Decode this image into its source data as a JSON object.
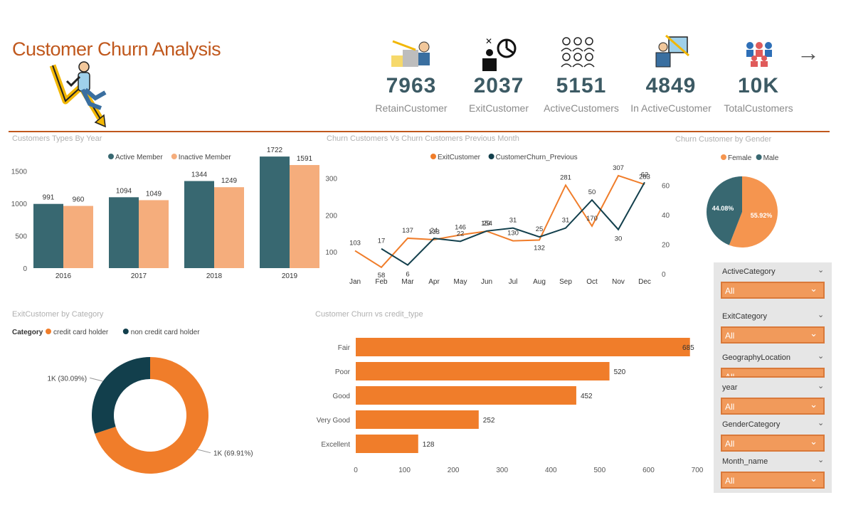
{
  "header": {
    "title": "Customer Churn Analysis",
    "next_icon": "arrow-right-icon"
  },
  "kpis": [
    {
      "value": "7963",
      "label": "RetainCustomer",
      "icon": "retain-customer-icon"
    },
    {
      "value": "2037",
      "label": "ExitCustomer",
      "icon": "exit-customer-icon"
    },
    {
      "value": "5151",
      "label": "ActiveCustomers",
      "icon": "active-customers-icon"
    },
    {
      "value": "4849",
      "label": "In ActiveCustomer",
      "icon": "inactive-customer-icon"
    },
    {
      "value": "10K",
      "label": "TotalCustomers",
      "icon": "total-customers-icon"
    }
  ],
  "colors": {
    "accent": "#c0581d",
    "teal": "#386871",
    "dark_teal": "#123f4c",
    "orange": "#f07d2a",
    "peach": "#f5ad7c"
  },
  "chart_data": [
    {
      "id": "types_by_year",
      "type": "bar",
      "title": "Customers Types By Year",
      "categories": [
        "2016",
        "2017",
        "2018",
        "2019"
      ],
      "series": [
        {
          "name": "Active Member",
          "values": [
            991,
            1094,
            1344,
            1722
          ],
          "color": "#386871"
        },
        {
          "name": "Inactive Member",
          "values": [
            960,
            1049,
            1249,
            1591
          ],
          "color": "#f5ad7c"
        }
      ],
      "yticks": [
        "0",
        "500",
        "1000",
        "1500"
      ],
      "ylim": [
        0,
        1800
      ],
      "legend": "top"
    },
    {
      "id": "churn_vs_prev",
      "type": "line",
      "title": "Churn Customers Vs Churn Customers Previous Month",
      "categories": [
        "Jan",
        "Feb",
        "Mar",
        "Apr",
        "May",
        "Jun",
        "Jul",
        "Aug",
        "Sep",
        "Oct",
        "Nov",
        "Dec"
      ],
      "series": [
        {
          "name": "ExitCustomer",
          "values": [
            103,
            58,
            137,
            133,
            146,
            156,
            130,
            132,
            281,
            170,
            307,
            283
          ],
          "labels": [
            "103",
            "58",
            "137",
            "133",
            "146",
            "154",
            "130",
            "132",
            "281",
            "170",
            "307",
            "283"
          ],
          "color": "#f07d2a",
          "axis": "left"
        },
        {
          "name": "CustomerChurn_Previous",
          "values": [
            null,
            17,
            6,
            24,
            22,
            29,
            31,
            25,
            31,
            50,
            30,
            62
          ],
          "labels": [
            "",
            "17",
            "6",
            "24",
            "22",
            "29",
            "31",
            "25",
            "31",
            "50",
            "30",
            "62"
          ],
          "color": "#123f4c",
          "axis": "right"
        }
      ],
      "yticks_left": [
        "100",
        "200",
        "300"
      ],
      "ylim_left": [
        50,
        330
      ],
      "yticks_right": [
        "0",
        "20",
        "40",
        "60"
      ],
      "ylim_right": [
        0,
        66
      ],
      "legend": "top"
    },
    {
      "id": "churn_by_gender",
      "type": "pie",
      "title": "Churn Customer by Gender",
      "slices": [
        {
          "name": "Female",
          "value": 55.92,
          "label": "55.92%",
          "color": "#f5954f"
        },
        {
          "name": "Male",
          "value": 44.08,
          "label": "44.08%",
          "color": "#386871"
        }
      ],
      "legend": "top"
    },
    {
      "id": "exit_by_category",
      "type": "pie",
      "title": "ExitCustomer by Category",
      "legend_title": "Category",
      "slices": [
        {
          "name": "credit card holder",
          "value": 69.91,
          "label": "1K (69.91%)",
          "color": "#f07d2a"
        },
        {
          "name": "non credit card holder",
          "value": 30.09,
          "label": "1K (30.09%)",
          "color": "#123f4c"
        }
      ],
      "legend": "top-left"
    },
    {
      "id": "churn_vs_credit",
      "type": "bar",
      "orientation": "horizontal",
      "title": "Customer Churn vs credit_type",
      "categories": [
        "Fair",
        "Poor",
        "Good",
        "Very Good",
        "Excellent"
      ],
      "values": [
        685,
        520,
        452,
        252,
        128
      ],
      "xticks": [
        "0",
        "100",
        "200",
        "300",
        "400",
        "500",
        "600",
        "700"
      ],
      "xlim": [
        0,
        700
      ],
      "color": "#f07d2a"
    }
  ],
  "slicers": [
    {
      "label": "ActiveCategory",
      "value": "All"
    },
    {
      "label": "ExitCategory",
      "value": "All"
    },
    {
      "label": "GeographyLocation",
      "value": "All"
    },
    {
      "label": "year",
      "value": "All"
    },
    {
      "label": "GenderCategory",
      "value": "All"
    },
    {
      "label": "Month_name",
      "value": "All"
    }
  ]
}
